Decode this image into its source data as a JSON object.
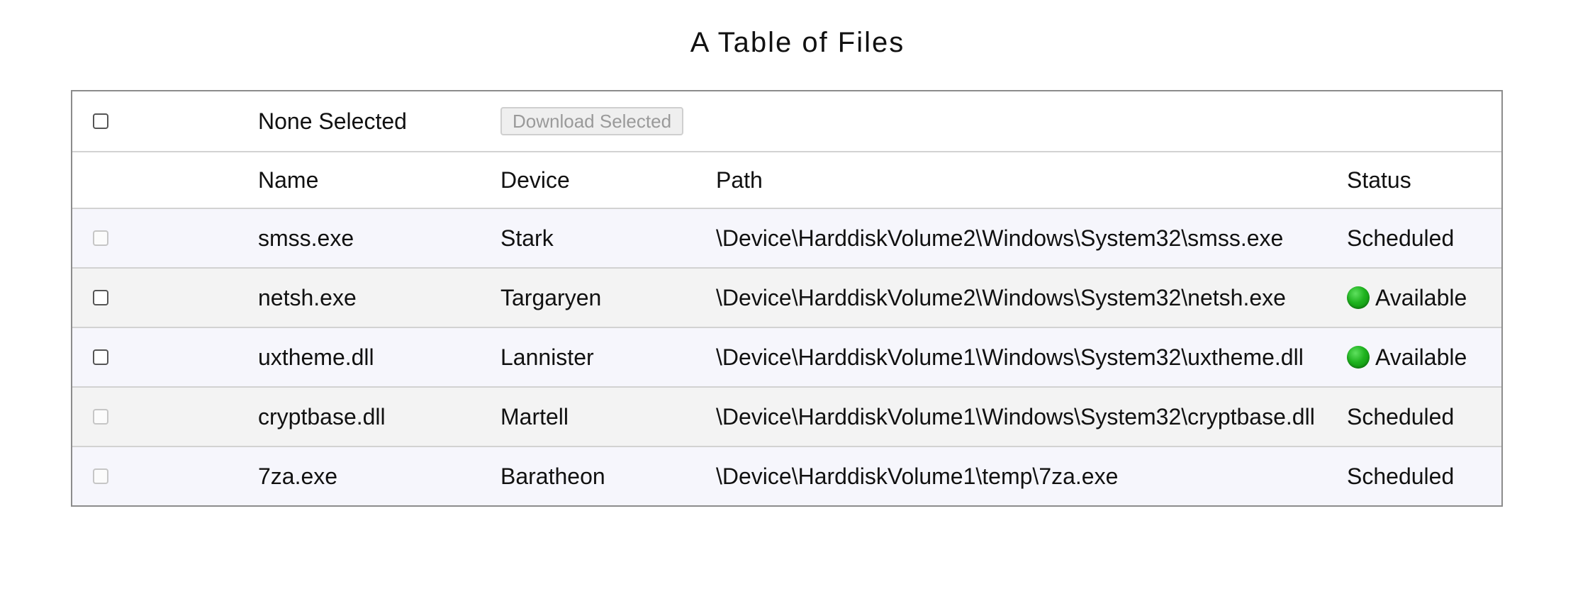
{
  "title": "A Table of Files",
  "toolbar": {
    "selection_label": "None Selected",
    "download_label": "Download Selected"
  },
  "columns": {
    "name": "Name",
    "device": "Device",
    "path": "Path",
    "status": "Status"
  },
  "rows": [
    {
      "name": "smss.exe",
      "device": "Stark",
      "path": "\\Device\\HarddiskVolume2\\Windows\\System32\\smss.exe",
      "status": "Scheduled",
      "selectable": false,
      "available": false
    },
    {
      "name": "netsh.exe",
      "device": "Targaryen",
      "path": "\\Device\\HarddiskVolume2\\Windows\\System32\\netsh.exe",
      "status": "Available",
      "selectable": true,
      "available": true
    },
    {
      "name": "uxtheme.dll",
      "device": "Lannister",
      "path": "\\Device\\HarddiskVolume1\\Windows\\System32\\uxtheme.dll",
      "status": "Available",
      "selectable": true,
      "available": true
    },
    {
      "name": "cryptbase.dll",
      "device": "Martell",
      "path": "\\Device\\HarddiskVolume1\\Windows\\System32\\cryptbase.dll",
      "status": "Scheduled",
      "selectable": false,
      "available": false
    },
    {
      "name": "7za.exe",
      "device": "Baratheon",
      "path": "\\Device\\HarddiskVolume1\\temp\\7za.exe",
      "status": "Scheduled",
      "selectable": false,
      "available": false
    }
  ],
  "colors": {
    "status_available": "#1fb21f",
    "row_odd": "#f6f6fc",
    "row_even": "#f3f3f3"
  },
  "icons": {
    "status_available": "green-dot-icon"
  }
}
